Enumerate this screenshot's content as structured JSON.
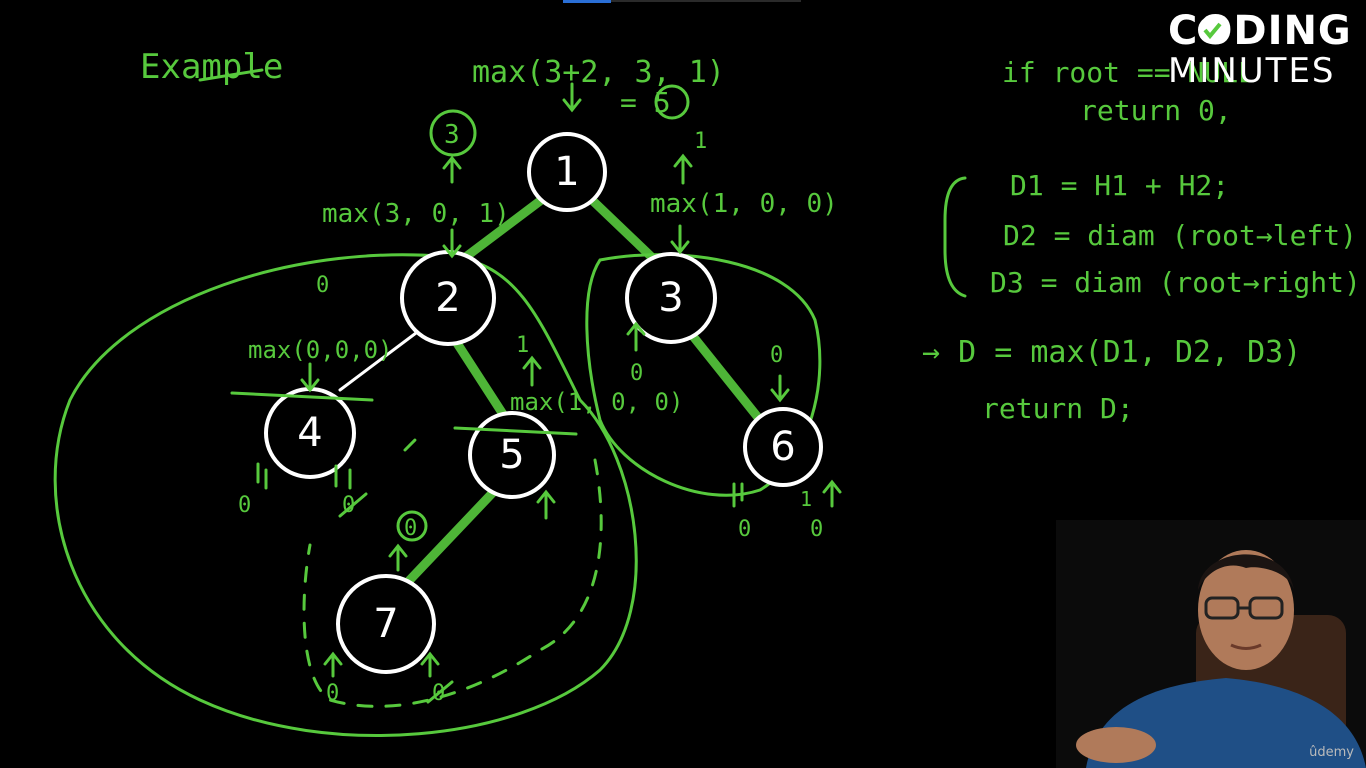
{
  "heading": "Example",
  "root_expr": "max(3+2, 3, 1)",
  "root_result": "= 5",
  "root_result_value": "5",
  "nodes": [
    "1",
    "2",
    "3",
    "4",
    "5",
    "6",
    "7"
  ],
  "annotations": {
    "left_up_value": "3",
    "node2_incoming": "max(3, 0, 1)",
    "node3_incoming": "max(1, 0, 0)",
    "node3_up_value": "1",
    "node4_incoming": "max(0,0,0)",
    "node4_top_zero": "0",
    "node5_incoming": "max(1, 0, 0)",
    "node5_up_value": "1",
    "node3_left_zero": "0",
    "node6_up_zero": "0",
    "node7_up_value": "0",
    "node4_left_leaf": "0",
    "node4_right_leaf": "0",
    "node6_left_leaf": "0",
    "node6_right_leaf": "0",
    "node6_right_one": "1",
    "node7_left_leaf": "0",
    "node7_right_leaf": "0"
  },
  "code": {
    "line1": "if  root == NULL",
    "line2": "return 0,",
    "line3": "D1 = H1 + H2;",
    "line4": "D2 = diam (root→left)",
    "line5": "D3 = diam (root→right)",
    "line6": "→ D = max(D1, D2, D3)",
    "line7": "return  D;"
  },
  "brand": {
    "line1": "CODING",
    "line2": "MINUTES",
    "check_color": "#57c93d"
  },
  "watermark": "ûdemy",
  "colors": {
    "ink_green": "#57c93d",
    "node_white": "#ffffff",
    "background": "#000000"
  }
}
